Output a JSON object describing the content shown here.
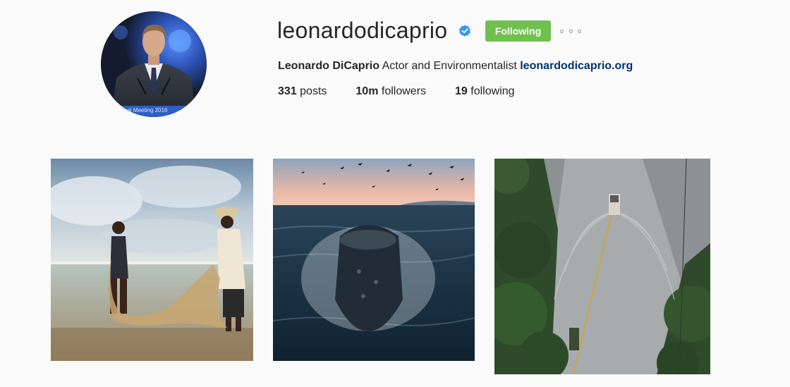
{
  "profile": {
    "username": "leonardodicaprio",
    "verified": true,
    "follow_button_label": "Following",
    "more_options_icon": "ellipsis-icon",
    "full_name": "Leonardo DiCaprio",
    "bio_text": "Actor and Environmentalist",
    "website": "leonardodicaprio.org",
    "avatar_caption": "ual Meeting 2016"
  },
  "stats": {
    "posts_count": "331",
    "posts_label": "posts",
    "followers_count": "10m",
    "followers_label": "followers",
    "following_count": "19",
    "following_label": "following"
  },
  "colors": {
    "follow_button": "#70c050",
    "verified_badge": "#3897f0",
    "link": "#003569"
  }
}
